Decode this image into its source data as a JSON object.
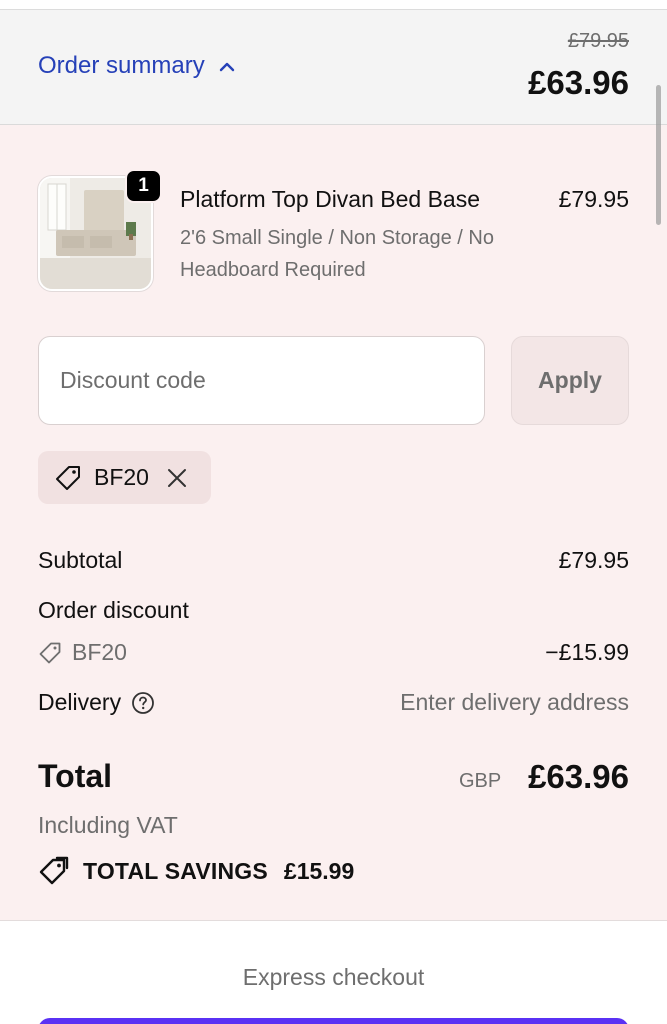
{
  "summary": {
    "toggle_label": "Order summary",
    "original_price": "£79.95",
    "total": "£63.96"
  },
  "product": {
    "quantity": "1",
    "name": "Platform Top Divan Bed Base",
    "variant": "2'6 Small Single / Non Storage / No Headboard Required",
    "price": "£79.95"
  },
  "discount": {
    "placeholder": "Discount code",
    "apply_label": "Apply",
    "applied_code": "BF20"
  },
  "costs": {
    "subtotal_label": "Subtotal",
    "subtotal_value": "£79.95",
    "order_discount_label": "Order discount",
    "discount_code": "BF20",
    "discount_value": "−£15.99",
    "delivery_label": "Delivery",
    "delivery_value": "Enter delivery address"
  },
  "total": {
    "label": "Total",
    "currency": "GBP",
    "value": "£63.96",
    "vat_note": "Including VAT",
    "savings_label": "TOTAL SAVINGS",
    "savings_value": "£15.99"
  },
  "checkout": {
    "express_label": "Express checkout"
  },
  "colors": {
    "link": "#2641b8",
    "panel_background": "#fbf0f0",
    "header_background": "#f4f4f4",
    "express_button": "#5a31f4"
  },
  "icons": [
    "chevron-up-icon",
    "tag-icon",
    "close-icon",
    "help-icon",
    "savings-tag-icon"
  ]
}
